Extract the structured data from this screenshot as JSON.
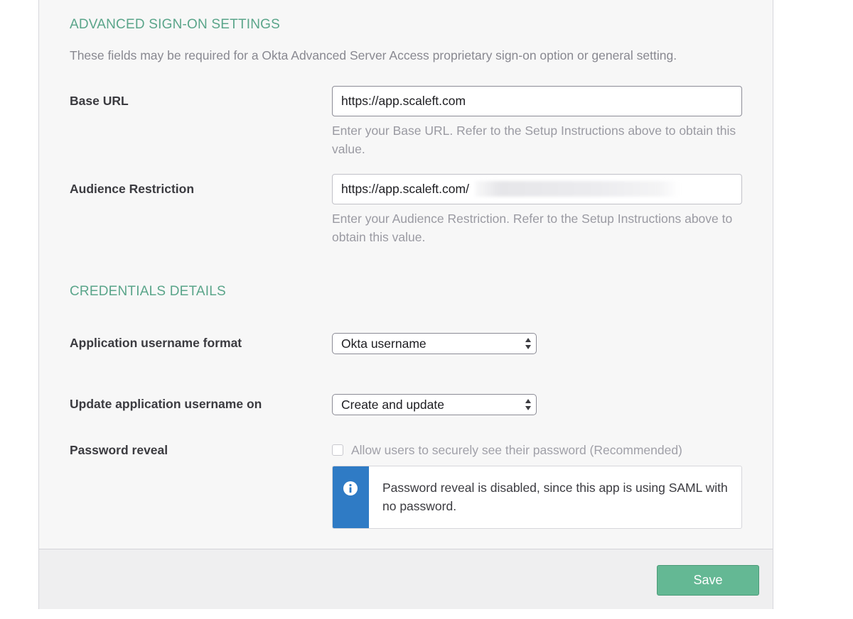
{
  "advanced": {
    "title": "ADVANCED SIGN-ON SETTINGS",
    "description": "These fields may be required for a Okta Advanced Server Access proprietary sign-on option or general setting.",
    "base_url": {
      "label": "Base URL",
      "value": "https://app.scaleft.com",
      "hint": "Enter your Base URL. Refer to the Setup Instructions above to obtain this value."
    },
    "audience": {
      "label": "Audience Restriction",
      "value": "https://app.scaleft.com/",
      "hint": "Enter your Audience Restriction. Refer to the Setup Instructions above to obtain this value."
    }
  },
  "credentials": {
    "title": "CREDENTIALS DETAILS",
    "username_format": {
      "label": "Application username format",
      "selected": "Okta username"
    },
    "update_on": {
      "label": "Update application username on",
      "selected": "Create and update"
    },
    "password_reveal": {
      "label": "Password reveal",
      "checkbox_label": "Allow users to securely see their password (Recommended)",
      "checked": false,
      "info_message": "Password reveal is disabled, since this app is using SAML with no password."
    }
  },
  "footer": {
    "save_label": "Save"
  },
  "colors": {
    "section_title": "#5aa58a",
    "save_button": "#64b894",
    "info_stripe": "#2f7bc5"
  },
  "icons": {
    "info": "info-circle-icon",
    "select_arrows": "sort-arrows-icon"
  }
}
